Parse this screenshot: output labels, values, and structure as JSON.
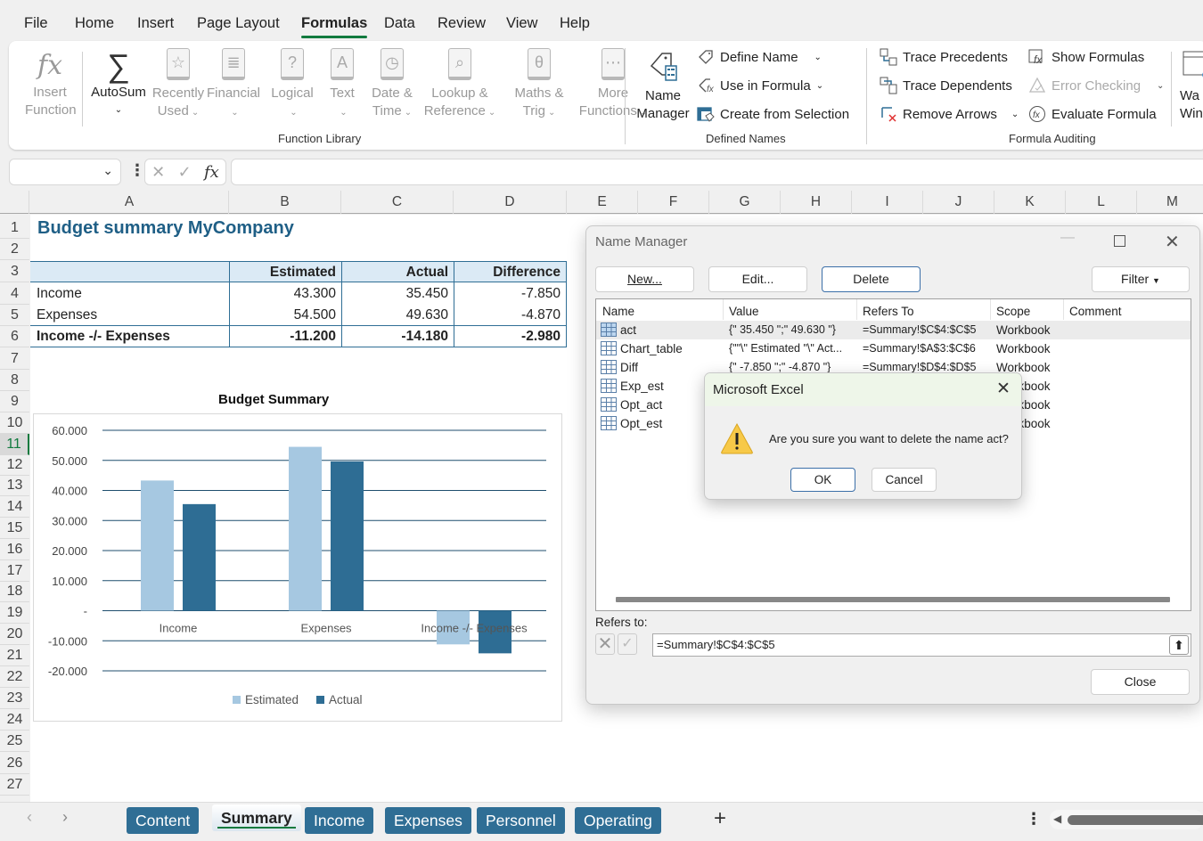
{
  "menu": [
    "File",
    "Home",
    "Insert",
    "Page Layout",
    "Formulas",
    "Data",
    "Review",
    "View",
    "Help"
  ],
  "menu_active": "Formulas",
  "ribbon": {
    "function_library": {
      "label": "Function Library",
      "insert_function": [
        "Insert",
        "Function"
      ],
      "autosum": "AutoSum",
      "buttons": [
        {
          "l1": "Recently",
          "l2": "Used",
          "icon": "star-book-icon"
        },
        {
          "l1": "Financial",
          "l2": "",
          "icon": "coins-book-icon"
        },
        {
          "l1": "Logical",
          "l2": "",
          "icon": "question-book-icon"
        },
        {
          "l1": "Text",
          "l2": "",
          "icon": "letter-book-icon"
        },
        {
          "l1": "Date &",
          "l2": "Time",
          "icon": "clock-book-icon"
        },
        {
          "l1": "Lookup &",
          "l2": "Reference",
          "icon": "magnifier-book-icon"
        },
        {
          "l1": "Maths &",
          "l2": "Trig",
          "icon": "theta-book-icon"
        },
        {
          "l1": "More",
          "l2": "Functions",
          "icon": "dots-book-icon"
        }
      ]
    },
    "defined_names": {
      "label": "Defined Names",
      "name_manager": [
        "Name",
        "Manager"
      ],
      "define_name": "Define Name",
      "use_in_formula": "Use in Formula",
      "create_from_selection": "Create from Selection"
    },
    "formula_auditing": {
      "label": "Formula Auditing",
      "trace_precedents": "Trace Precedents",
      "trace_dependents": "Trace Dependents",
      "remove_arrows": "Remove Arrows",
      "show_formulas": "Show Formulas",
      "error_checking": "Error Checking",
      "evaluate_formula": "Evaluate Formula"
    },
    "watch_window": [
      "Wa",
      "Win"
    ]
  },
  "formula_bar": {
    "name_box": "",
    "formula": "",
    "fx": "fx"
  },
  "columns": [
    "A",
    "B",
    "C",
    "D",
    "E",
    "F",
    "G",
    "H",
    "I",
    "J",
    "K",
    "L",
    "M"
  ],
  "rows": [
    "1",
    "2",
    "3",
    "4",
    "5",
    "6",
    "7",
    "8",
    "9",
    "10",
    "11",
    "12",
    "13",
    "14",
    "15",
    "16",
    "17",
    "18",
    "19",
    "20",
    "21",
    "22",
    "23",
    "24",
    "25",
    "26",
    "27"
  ],
  "selected_row": "11",
  "sheet": {
    "title": "Budget summary MyCompany",
    "table_header": [
      "",
      "Estimated",
      "Actual",
      "Difference"
    ],
    "table_rows": [
      [
        "Income",
        "43.300",
        "35.450",
        "-7.850"
      ],
      [
        "Expenses",
        "54.500",
        "49.630",
        "-4.870"
      ],
      [
        "Income -/- Expenses",
        "-11.200",
        "-14.180",
        "-2.980"
      ]
    ]
  },
  "chart_data": {
    "type": "bar",
    "title": "Budget Summary",
    "categories": [
      "Income",
      "Expenses",
      "Income -/- Expenses"
    ],
    "series": [
      {
        "name": "Estimated",
        "values": [
          43300,
          54500,
          -11200
        ],
        "color": "#a6c8e1"
      },
      {
        "name": "Actual",
        "values": [
          35450,
          49630,
          -14180
        ],
        "color": "#2e6d94"
      }
    ],
    "yticks": [
      60000,
      50000,
      40000,
      30000,
      20000,
      10000,
      0,
      -10000,
      -20000
    ],
    "ytick_labels": [
      "60.000",
      "50.000",
      "40.000",
      "30.000",
      "20.000",
      "10.000",
      "-",
      "-10.000",
      "-20.000"
    ],
    "ylim": [
      -20000,
      60000
    ],
    "xlabel": "",
    "ylabel": "",
    "grid": true,
    "legend": "bottom"
  },
  "sheet_tabs": [
    "Content",
    "Summary",
    "Income",
    "Expenses",
    "Personnel",
    "Operating"
  ],
  "active_tab": "Summary",
  "name_manager": {
    "title": "Name Manager",
    "buttons": {
      "new": "New...",
      "edit": "Edit...",
      "delete": "Delete",
      "filter": "Filter",
      "close": "Close"
    },
    "columns": [
      "Name",
      "Value",
      "Refers To",
      "Scope",
      "Comment"
    ],
    "rows": [
      {
        "name": "act",
        "value": "{\" 35.450 \";\" 49.630 \"}",
        "refers": "=Summary!$C$4:$C$5",
        "scope": "Workbook",
        "comment": ""
      },
      {
        "name": "Chart_table",
        "value": "{\"\"\\\" Estimated \"\\\" Act...",
        "refers": "=Summary!$A$3:$C$6",
        "scope": "Workbook",
        "comment": ""
      },
      {
        "name": "Diff",
        "value": "{\" -7.850 \";\" -4.870 \"}",
        "refers": "=Summary!$D$4:$D$5",
        "scope": "Workbook",
        "comment": ""
      },
      {
        "name": "Exp_est",
        "value": "",
        "refers": "",
        "scope": "Workbook",
        "comment": ""
      },
      {
        "name": "Opt_act",
        "value": "",
        "refers": "",
        "scope": "Workbook",
        "comment": ""
      },
      {
        "name": "Opt_est",
        "value": "",
        "refers": "",
        "scope": "Workbook",
        "comment": ""
      }
    ],
    "refers_to_label": "Refers to:",
    "refers_to_value": "=Summary!$C$4:$C$5"
  },
  "message_box": {
    "title": "Microsoft Excel",
    "text": "Are you sure you want to delete the name act?",
    "ok": "OK",
    "cancel": "Cancel"
  }
}
